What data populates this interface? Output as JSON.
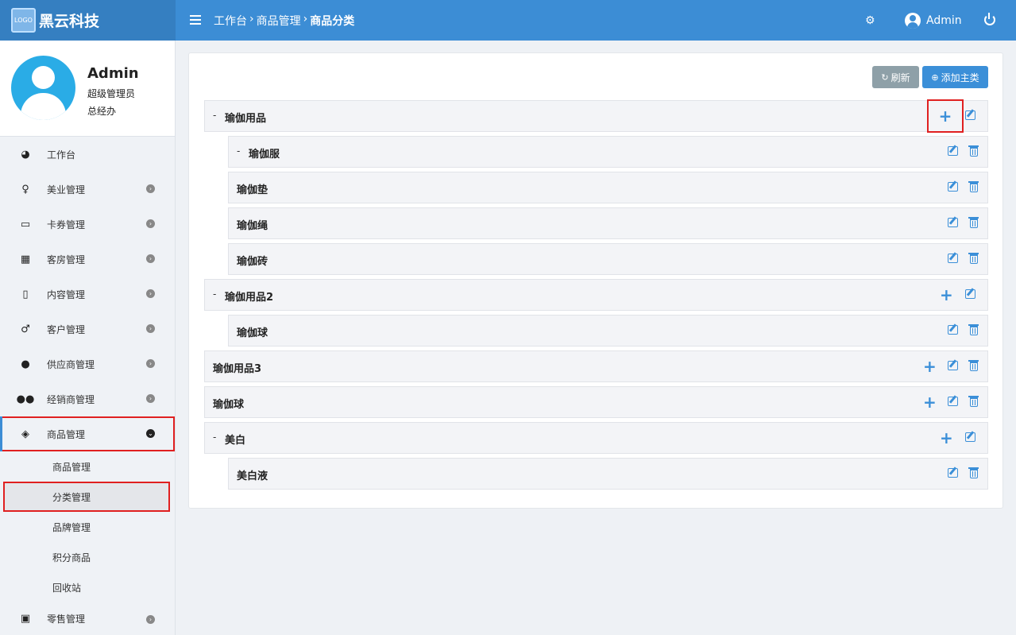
{
  "brand": {
    "logo_text": "黑云科技",
    "name": "黑云科技"
  },
  "breadcrumb": {
    "items": [
      "工作台",
      "商品管理",
      "商品分类"
    ],
    "separator": "›"
  },
  "user": {
    "name": "Admin"
  },
  "profile": {
    "name": "Admin",
    "role": "超级管理员",
    "department": "总经办"
  },
  "sidebar": {
    "items": [
      {
        "label": "工作台",
        "icon": "dashboard-icon"
      },
      {
        "label": "美业管理",
        "icon": "female-icon"
      },
      {
        "label": "卡券管理",
        "icon": "credit-card-icon"
      },
      {
        "label": "客房管理",
        "icon": "building-icon"
      },
      {
        "label": "内容管理",
        "icon": "file-icon"
      },
      {
        "label": "客户管理",
        "icon": "male-icon"
      },
      {
        "label": "供应商管理",
        "icon": "user-icon"
      },
      {
        "label": "经销商管理",
        "icon": "users-icon"
      },
      {
        "label": "商品管理",
        "icon": "cubes-icon"
      },
      {
        "label": "零售管理",
        "icon": "money-icon"
      }
    ],
    "sub_items": [
      "商品管理",
      "分类管理",
      "品牌管理",
      "积分商品",
      "回收站"
    ]
  },
  "toolbar": {
    "refresh_label": "刷新",
    "add_label": "添加主类"
  },
  "categories": [
    {
      "label": "瑜伽用品"
    },
    {
      "label": "瑜伽服"
    },
    {
      "label": "瑜伽垫"
    },
    {
      "label": "瑜伽绳"
    },
    {
      "label": "瑜伽砖"
    },
    {
      "label": "瑜伽用品2"
    },
    {
      "label": "瑜伽球"
    },
    {
      "label": "瑜伽用品3"
    },
    {
      "label": "瑜伽球"
    },
    {
      "label": "美白"
    },
    {
      "label": "美白液"
    }
  ],
  "dash": "-"
}
